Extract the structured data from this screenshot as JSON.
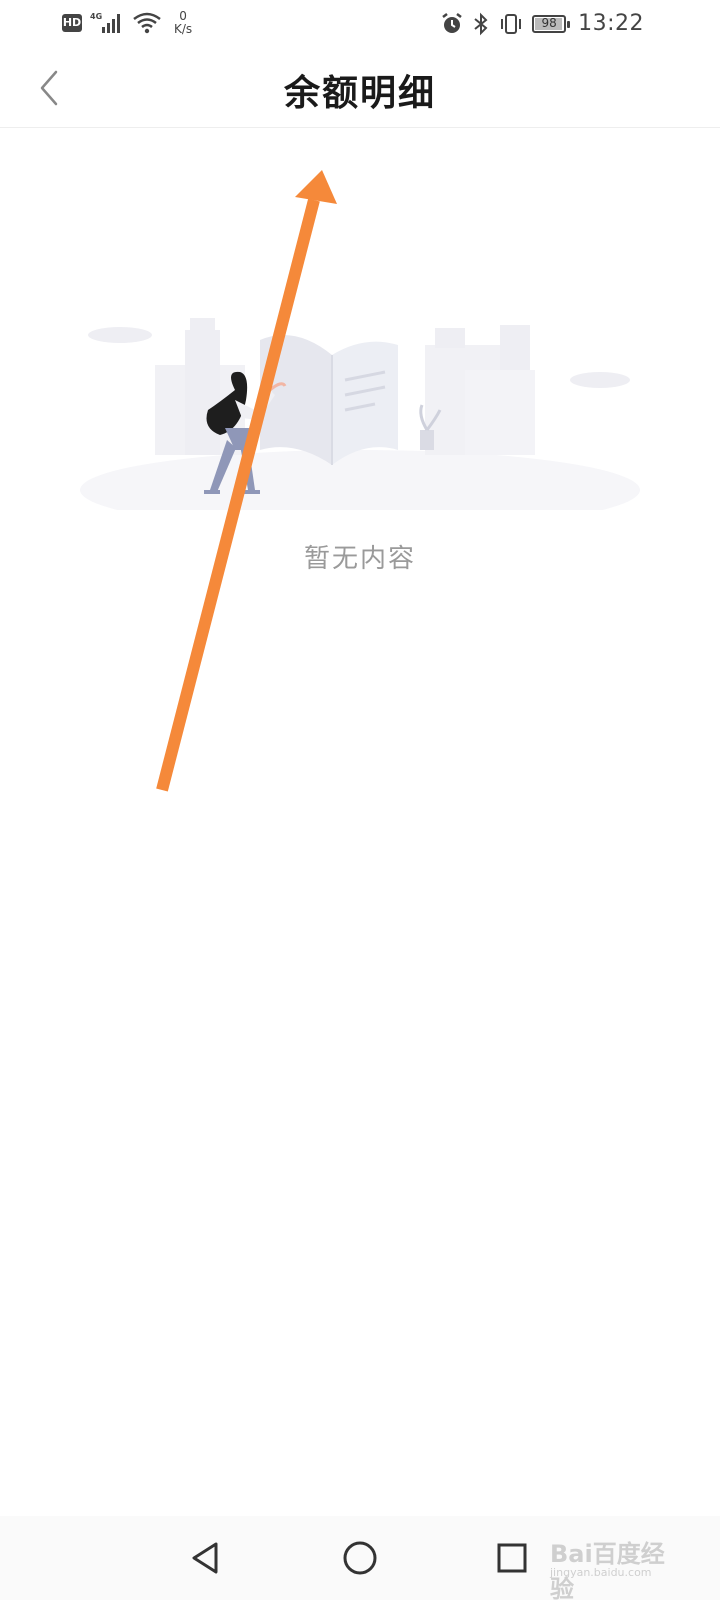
{
  "status_bar": {
    "hd": "HD",
    "network": "4G",
    "speed_value": "0",
    "speed_unit": "K/s",
    "battery": "98",
    "battery_level": 0.98,
    "time": "13:22",
    "icons": [
      "hd-icon",
      "signal-icon",
      "wifi-icon",
      "alarm-icon",
      "bluetooth-icon",
      "vibrate-icon",
      "battery-icon"
    ]
  },
  "header": {
    "title": "余额明细",
    "back_icon": "chevron-left-icon"
  },
  "empty_state": {
    "message": "暂无内容",
    "illustration": "empty-book-illustration"
  },
  "annotation": {
    "color": "#f5893a",
    "icon": "arrow-annotation"
  },
  "system_nav": {
    "icons": [
      "back-triangle-icon",
      "home-circle-icon",
      "recents-square-icon"
    ]
  },
  "watermark": {
    "brand": "Bai百度经验",
    "sub": "jingyan.baidu.com"
  }
}
